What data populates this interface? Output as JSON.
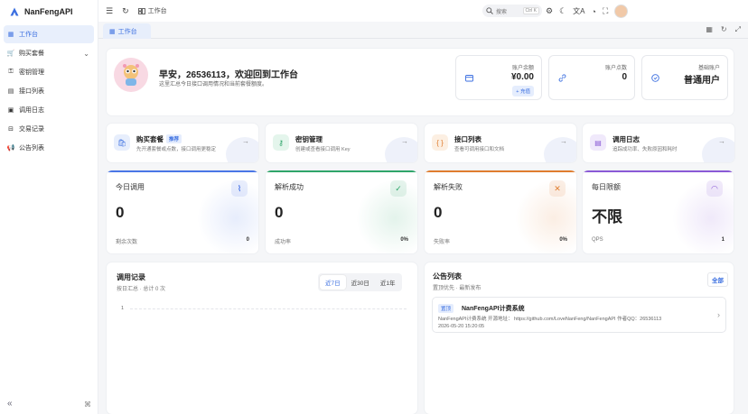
{
  "app": {
    "name": "NanFengAPI"
  },
  "sidebar": {
    "items": [
      {
        "label": "工作台",
        "icon": "dashboard-icon",
        "active": true
      },
      {
        "label": "购买套餐",
        "icon": "cart-icon",
        "expandable": true
      },
      {
        "label": "密钥管理",
        "icon": "key-icon"
      },
      {
        "label": "接口列表",
        "icon": "list-icon"
      },
      {
        "label": "调用日志",
        "icon": "log-icon"
      },
      {
        "label": "交易记录",
        "icon": "receipt-icon"
      },
      {
        "label": "公告列表",
        "icon": "megaphone-icon"
      }
    ],
    "collapse_glyph": "«"
  },
  "topbar": {
    "breadcrumb": "工作台",
    "search_placeholder": "搜索",
    "search_shortcut": "Ctrl K"
  },
  "tabs": [
    {
      "label": "工作台",
      "active": true
    }
  ],
  "welcome": {
    "title": "早安，26536113，欢迎回到工作台",
    "subtitle": "这里汇总今日接口调用情况和当前套餐额度。"
  },
  "stats": [
    {
      "label": "账户余额",
      "value": "¥0.00",
      "action": "+ 充值",
      "icon": "wallet-icon"
    },
    {
      "label": "账户点数",
      "value": "0",
      "icon": "link-icon"
    },
    {
      "label": "基础账户",
      "value": "普通用户",
      "icon": "user-circle-icon"
    }
  ],
  "quick": [
    {
      "title": "购买套餐",
      "badge": "推荐",
      "desc": "先开通套餐或点数，接口调用更稳定",
      "color": "#3b6fe0",
      "bg": "#e7eefc",
      "icon": "bag-icon"
    },
    {
      "title": "密钥管理",
      "desc": "创建或查看接口调用 Key",
      "color": "#2fa56a",
      "bg": "#e4f5ec",
      "icon": "key-icon"
    },
    {
      "title": "接口列表",
      "desc": "查看可调用接口和文档",
      "color": "#e07d2f",
      "bg": "#fcefe2",
      "icon": "braces-icon"
    },
    {
      "title": "调用日志",
      "desc": "追踪成功率、失败原因和耗时",
      "color": "#8a5ad6",
      "bg": "#f0e9fb",
      "icon": "clipboard-icon"
    }
  ],
  "metrics": [
    {
      "title": "今日调用",
      "value": "0",
      "foot_label": "剩余次数",
      "foot_value": "0",
      "color": "#4a76e6",
      "icon": "activity-icon"
    },
    {
      "title": "解析成功",
      "value": "0",
      "foot_label": "成功率",
      "foot_value": "0%",
      "color": "#2fa56a",
      "icon": "check-circle-icon"
    },
    {
      "title": "解析失败",
      "value": "0",
      "foot_label": "失败率",
      "foot_value": "0%",
      "color": "#e07d2f",
      "icon": "x-circle-icon"
    },
    {
      "title": "每日限额",
      "value": "不限",
      "foot_label": "QPS",
      "foot_value": "1",
      "color": "#8a5ad6",
      "icon": "gauge-icon"
    }
  ],
  "calls": {
    "title": "调用记录",
    "subtitle": "按日汇总 · 总计 0 次",
    "ranges": [
      "近7日",
      "近30日",
      "近1年"
    ],
    "active_range": "近7日",
    "y_tick": "1"
  },
  "notices": {
    "title": "公告列表",
    "subtitle": "置顶优先 · 最新发布",
    "all_label": "全部",
    "items": [
      {
        "tag": "置顶",
        "title": "NanFengAPI计费系统",
        "desc": "NanFengAPI计费系统 开源地址： https://github.com/LoveNanFeng/NanFengAPI 作者QQ：26536113",
        "time": "2026-05-20 15:20:05"
      }
    ]
  }
}
